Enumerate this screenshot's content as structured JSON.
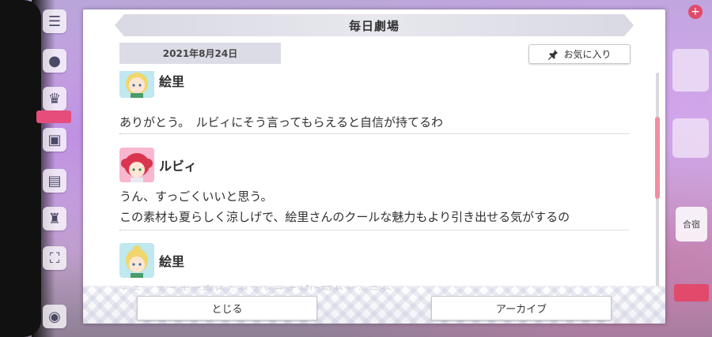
{
  "dialog": {
    "title": "毎日劇場",
    "date": "2021年8月24日",
    "favorite_label": "お気に入り"
  },
  "messages": [
    {
      "speaker": "絵里",
      "avatar": "eli-avatar",
      "lines": [
        "ありがとう。　ルビィにそう言ってもらえると自信が持てるわ"
      ]
    },
    {
      "speaker": "ルビィ",
      "avatar": "ruby-avatar",
      "lines": [
        "うん、すっごくいいと思う。",
        "この素材も夏らしく涼しげで、絵里さんのクールな魅力もより引き出せる気がするの"
      ]
    },
    {
      "speaker": "絵里",
      "avatar": "eli-avatar",
      "lines": [
        "もう、そこまで褒められるとさすがに照れちゃうわ"
      ]
    }
  ],
  "footer": {
    "close_label": "とじる",
    "archive_label": "アーカイブ"
  },
  "background": {
    "right_label": "合宿"
  },
  "colors": {
    "scroll_thumb": "#f08ea2",
    "header_bg": "#dcdce6",
    "accent": "#e14a6a"
  }
}
